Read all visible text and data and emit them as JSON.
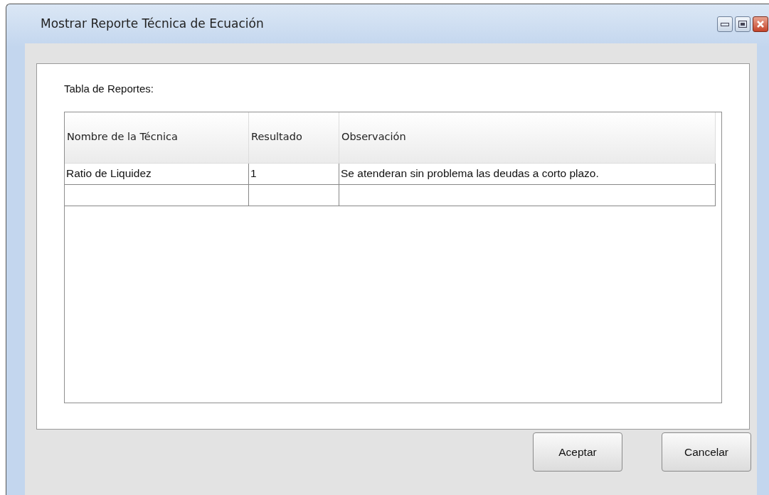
{
  "window": {
    "title": "Mostrar Reporte Técnica de Ecuación"
  },
  "table_label": "Tabla de Reportes:",
  "table": {
    "columns": [
      "Nombre de la Técnica",
      "Resultado",
      "Observación"
    ],
    "rows": [
      [
        "Ratio de Liquidez",
        "1",
        "Se atenderan sin problema las deudas a corto plazo."
      ]
    ]
  },
  "buttons": [
    "Aceptar",
    "Cancelar"
  ]
}
